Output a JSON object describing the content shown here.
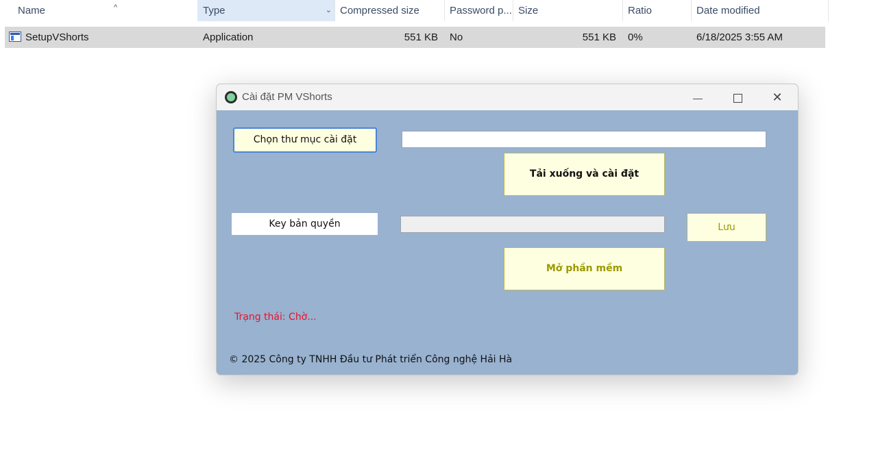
{
  "explorer": {
    "columns": {
      "name": "Name",
      "type": "Type",
      "compressed_size": "Compressed size",
      "password": "Password p...",
      "size": "Size",
      "ratio": "Ratio",
      "date_modified": "Date modified"
    },
    "sort_indicator": "^",
    "type_dropdown_icon": "chevron-down",
    "rows": [
      {
        "name": "SetupVShorts",
        "type": "Application",
        "compressed_size": "551 KB",
        "password": "No",
        "size": "551 KB",
        "ratio": "0%",
        "date_modified": "6/18/2025 3:55 AM"
      }
    ]
  },
  "dialog": {
    "title": "Cài đặt PM VShorts",
    "title_buttons": {
      "minimize": "—",
      "close": "✕"
    },
    "choose_folder_label": "Chọn thư mục cài đặt",
    "install_path_value": "",
    "download_install_label": "Tải xuống và cài đặt",
    "license_key_label": "Key bản quyền",
    "license_key_value": "",
    "save_label": "Lưu",
    "open_app_label": "Mở phần mềm",
    "status_text": "Trạng thái: Chờ...",
    "copyright": "© 2025 Công ty TNHH Đầu tư Phát triển Công nghệ Hải Hà",
    "colors": {
      "window_bg": "#98b2d0",
      "button_bg": "#fefee0",
      "status": "#e8122c",
      "accent_button_text": "#9a9a00"
    }
  }
}
